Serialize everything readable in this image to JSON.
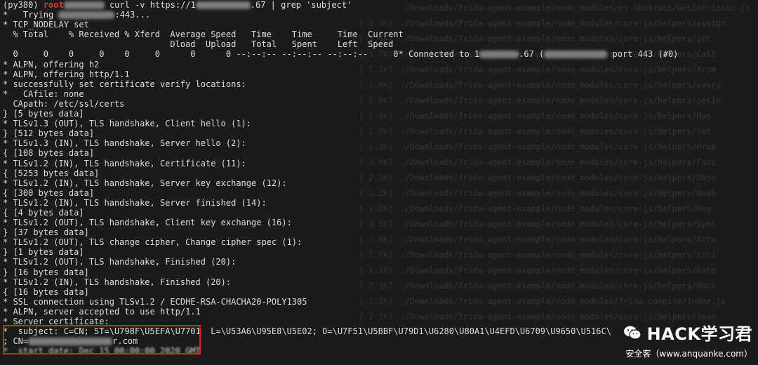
{
  "prompt": {
    "env": "(py380)",
    "user": "root",
    "command": "curl -v https://1",
    "command_tail": ".67 | grep 'subject'"
  },
  "lines": [
    "*   Trying ",
    "* TCP_NODELAY set",
    "  % Total    % Received % Xferd  Average Speed   Time    Time     Time  Current",
    "                                 Dload  Upload   Total   Spent    Left  Speed",
    "  0     0    0     0    0     0      0      0 --:--:-- --:--:-- --:--:--     0* Connected to 1",
    "* ALPN, offering h2",
    "* ALPN, offering http/1.1",
    "* successfully set certificate verify locations:",
    "*   CAfile: none",
    "  CApath: /etc/ssl/certs",
    "} [5 bytes data]",
    "* TLSv1.3 (OUT), TLS handshake, Client hello (1):",
    "} [512 bytes data]",
    "* TLSv1.3 (IN), TLS handshake, Server hello (2):",
    "{ [108 bytes data]",
    "* TLSv1.2 (IN), TLS handshake, Certificate (11):",
    "{ [5253 bytes data]",
    "* TLSv1.2 (IN), TLS handshake, Server key exchange (12):",
    "{ [300 bytes data]",
    "* TLSv1.2 (IN), TLS handshake, Server finished (14):",
    "{ [4 bytes data]",
    "* TLSv1.2 (OUT), TLS handshake, Client key exchange (16):",
    "} [37 bytes data]",
    "* TLSv1.2 (OUT), TLS change cipher, Change cipher spec (1):",
    "} [1 bytes data]",
    "* TLSv1.2 (OUT), TLS handshake, Finished (20):",
    "} [16 bytes data]",
    "* TLSv1.2 (IN), TLS handshake, Finished (20):",
    "{ [16 bytes data]",
    "* SSL connection using TLSv1.2 / ECDHE-RSA-CHACHA20-POLY1305",
    "* ALPN, server accepted to use http/1.1",
    "* Server certificate:",
    "*  subject: C=CN; ST=\\U798F\\U5EFA\\U7701  L=\\U53A6\\U95E8\\U5E02; O=\\U7F51\\U5BBF\\U79D1\\U6280\\U80A1\\U4EFD\\U6709\\U9650\\U516C\\",
    "; CN=",
    "*  start date: Dec 15 00:00:00 2020 GMT"
  ],
  "trying_tail": ":443...",
  "connected_tail": ".67 (",
  "connected_port": " port 443 (#0)",
  "cn_tail": "r.com",
  "ghost": [
    {
      "num": "",
      "text": "./Downloads/frida-agent-example/node_modules/es-abstract/GetIntrinsic.js"
    },
    {
      "num": "1.4K",
      "text": "./Downloads/frida-agent-example/node_modules/core-js/helpers/assign"
    },
    {
      "num": "1.6K",
      "text": "./Downloads/frida-agent-example/node_modules/core-js/helpers/get"
    },
    {
      "num": "1.7K",
      "text": "./Downloads/frida-agent-example/node_modules/core-js/helpers/Call"
    },
    {
      "num": "1.1K",
      "text": "./Downloads/frida-agent-example/node_modules/core-js/helpers/from"
    },
    {
      "num": "1.0K",
      "text": "./Downloads/frida-agent-example/node_modules/core-js/helpers/every"
    },
    {
      "num": "2.0K",
      "text": "./Downloads/frida-agent-example/node_modules/core-js/helpers/getIn"
    },
    {
      "num": "1.4K",
      "text": "./Downloads/frida-agent-example/node_modules/core-js/helpers/Map"
    },
    {
      "num": "1.9K",
      "text": "./Downloads/frida-agent-example/node_modules/core-js/helpers/Set"
    },
    {
      "num": "1.3K",
      "text": "./Downloads/frida-agent-example/node_modules/core-js/helpers/Prop"
    },
    {
      "num": "1.0K",
      "text": "./Downloads/frida-agent-example/node_modules/core-js/helpers/Func"
    },
    {
      "num": "2.3K",
      "text": "./Downloads/frida-agent-example/node_modules/core-js/helpers/Obje"
    },
    {
      "num": "1.2K",
      "text": "./Downloads/frida-agent-example/node_modules/core-js/helpers/Numb"
    },
    {
      "num": "1.6K",
      "text": "./Downloads/frida-agent-example/node_modules/core-js/helpers/Reg"
    },
    {
      "num": "1.5K",
      "text": "./Downloads/frida-agent-example/node_modules/core-js/helpers/Symb"
    },
    {
      "num": "1.4K",
      "text": "./Downloads/frida-agent-example/node_modules/core-js/helpers/Arra"
    },
    {
      "num": "1.7K",
      "text": "./Downloads/frida-agent-example/node_modules/core-js/helpers/Stri"
    },
    {
      "num": "1.1K",
      "text": "./Downloads/frida-agent-example/node_modules/core-js/helpers/Date"
    },
    {
      "num": "2.1K",
      "text": "./Downloads/frida-agent-example/node_modules/core-js/helpers/Math"
    },
    {
      "num": "1.3K",
      "text": "./Downloads/frida-agent-example/node_modules/frida-compile/index.js"
    },
    {
      "num": "2.7K",
      "text": "./Downloads/frida-agent-example/node_modules/core-js/helpers/Json"
    }
  ],
  "watermark": {
    "title": "HACK学习君",
    "subtitle": "安全客（www.anquanke.com）"
  }
}
